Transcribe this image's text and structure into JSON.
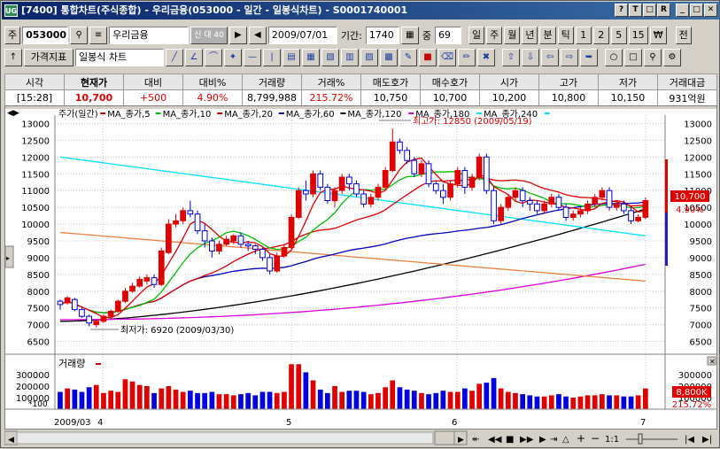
{
  "window": {
    "app_icon": "UG",
    "title": "[7400] 통합차트(주식종합) - 우리금융(053000 - 일간 - 일봉식차트) - S0001740001",
    "buttons": [
      "?",
      "T",
      "□",
      "R",
      "_",
      "□",
      "✕"
    ]
  },
  "toolbar1": {
    "code_prefix": "주",
    "stock_code": "053000",
    "stock_name": "우리금융",
    "credit_badge": "신 대 40",
    "date": "2009/07/01",
    "period_label": "기간:",
    "period_value": "1740",
    "zoom_label": "중",
    "zoom_value": "69",
    "period_buttons": [
      "일",
      "주",
      "월",
      "년",
      "분",
      "틱",
      "1",
      "2",
      "5",
      "15"
    ],
    "currency_button": "₩",
    "last_button": "전"
  },
  "toolbar2": {
    "index_button": "가격지표",
    "chart_type": "일봉식 차트",
    "tool_icons": [
      "line-icon",
      "angle-icon",
      "arc-icon",
      "fan-icon",
      "hline-icon",
      "vline-icon",
      "grid1-icon",
      "grid2-icon",
      "grid3-icon",
      "fib1-icon",
      "fib2-icon",
      "fib3-icon",
      "pencil-icon",
      "color-icon",
      "eraser-icon",
      "edit-icon",
      "delete-icon",
      "up-icon",
      "down-icon",
      "left-icon",
      "right-icon",
      "export-icon",
      "circle-icon",
      "square-icon",
      "zoom-icon",
      "setting-icon"
    ]
  },
  "quote": {
    "headers": [
      "시각",
      "현재가",
      "대비",
      "대비%",
      "거래량",
      "거래%",
      "매도호가",
      "매수호가",
      "시가",
      "고가",
      "저가",
      "거래대금"
    ],
    "values": [
      "[15:28]",
      "10,700",
      "+500",
      "4.90%",
      "8,799,988",
      "215.72%",
      "10,750",
      "10,700",
      "10,200",
      "10,800",
      "10,150",
      "931억원"
    ]
  },
  "chart": {
    "legend": [
      {
        "label": "주가(일간)",
        "color": "#000000"
      },
      {
        "label": "MA_종가,5",
        "color": "#e00000"
      },
      {
        "label": "MA_종가,10",
        "color": "#00c000"
      },
      {
        "label": "MA_종가,20",
        "color": "#e00000"
      },
      {
        "label": "MA_종가,60",
        "color": "#0000c0"
      },
      {
        "label": "MA_종가,120",
        "color": "#000000"
      },
      {
        "label": "MA_종가,180",
        "color": "#e000e0"
      },
      {
        "label": "MA_종가,240",
        "color": "#00e0ff"
      }
    ],
    "high_label": "최고가: 12850 (2009/05/19)",
    "low_label": "최저가: 6920 (2009/03/30)",
    "current_price_tag": "10,700",
    "current_pct_tag": "4.90%",
    "volume_title": "거래량",
    "volume_tag": "8,800K",
    "volume_pct": "215.72%",
    "volume_unit": "*100",
    "x_labels": [
      "2009/03",
      "4",
      "5",
      "6",
      "7"
    ],
    "price_ticks": [
      "13000",
      "12500",
      "12000",
      "11500",
      "11000",
      "10500",
      "10000",
      "9500",
      "9000",
      "8500",
      "8000",
      "7500",
      "7000",
      "6500"
    ],
    "volume_ticks": [
      "300000",
      "200000",
      "100000"
    ]
  },
  "chart_data": {
    "type": "candlestick",
    "title": "주가(일간)",
    "ylim": [
      6250,
      13250
    ],
    "high": {
      "value": 12850,
      "date": "2009/05/19"
    },
    "low": {
      "value": 6920,
      "date": "2009/03/30"
    },
    "candles": [
      [
        7700,
        7600,
        7750,
        7450
      ],
      [
        7650,
        7800,
        7850,
        7600
      ],
      [
        7750,
        7450,
        7800,
        7400
      ],
      [
        7450,
        7250,
        7500,
        7200
      ],
      [
        7250,
        7050,
        7300,
        6950
      ],
      [
        7000,
        7100,
        7150,
        6920
      ],
      [
        7100,
        7250,
        7300,
        7050
      ],
      [
        7250,
        7400,
        7450,
        7200
      ],
      [
        7400,
        7700,
        7750,
        7350
      ],
      [
        7700,
        8000,
        8100,
        7650
      ],
      [
        8000,
        8150,
        8250,
        7950
      ],
      [
        8150,
        8350,
        8450,
        8100
      ],
      [
        8300,
        8400,
        8500,
        8200
      ],
      [
        8400,
        8200,
        8500,
        8100
      ],
      [
        8200,
        9200,
        9300,
        8150
      ],
      [
        9150,
        10000,
        10150,
        9100
      ],
      [
        10000,
        10100,
        10300,
        9900
      ],
      [
        10100,
        10400,
        10500,
        10000
      ],
      [
        10400,
        10300,
        10700,
        10200
      ],
      [
        10300,
        9800,
        10400,
        9700
      ],
      [
        9800,
        9500,
        10000,
        9300
      ],
      [
        9500,
        9200,
        9600,
        9000
      ],
      [
        9200,
        9400,
        9500,
        9100
      ],
      [
        9400,
        9550,
        9650,
        9350
      ],
      [
        9500,
        9650,
        9700,
        9400
      ],
      [
        9650,
        9400,
        9750,
        9300
      ],
      [
        9400,
        9350,
        9500,
        9200
      ],
      [
        9350,
        9250,
        9400,
        9100
      ],
      [
        9250,
        9000,
        9300,
        8900
      ],
      [
        9000,
        8600,
        9100,
        8500
      ],
      [
        8600,
        9050,
        9150,
        8550
      ],
      [
        9050,
        9300,
        9400,
        9000
      ],
      [
        9300,
        10200,
        10300,
        9250
      ],
      [
        10200,
        11000,
        11100,
        10150
      ],
      [
        11000,
        10900,
        11300,
        10700
      ],
      [
        10900,
        11500,
        11600,
        10800
      ],
      [
        11500,
        11100,
        11600,
        11000
      ],
      [
        11100,
        10700,
        11200,
        10600
      ],
      [
        10700,
        11000,
        11100,
        10500
      ],
      [
        11000,
        11400,
        11500,
        10900
      ],
      [
        11400,
        11200,
        11500,
        11000
      ],
      [
        11200,
        10900,
        11300,
        10800
      ],
      [
        10900,
        10600,
        11000,
        10500
      ],
      [
        10600,
        10800,
        10900,
        10500
      ],
      [
        10800,
        11100,
        11200,
        10700
      ],
      [
        11100,
        11600,
        11700,
        11050
      ],
      [
        11600,
        12450,
        12850,
        11550
      ],
      [
        12450,
        12200,
        12550,
        12100
      ],
      [
        12200,
        11900,
        12300,
        11800
      ],
      [
        11900,
        11500,
        12000,
        11400
      ],
      [
        11500,
        11800,
        11900,
        11400
      ],
      [
        11800,
        11200,
        11900,
        11100
      ],
      [
        11200,
        11000,
        11300,
        10900
      ],
      [
        11000,
        10800,
        11200,
        10600
      ],
      [
        10800,
        11200,
        11300,
        10700
      ],
      [
        11200,
        11600,
        11700,
        11100
      ],
      [
        11600,
        11100,
        11700,
        10900
      ],
      [
        11100,
        11400,
        11500,
        11000
      ],
      [
        11400,
        12000,
        12100,
        11300
      ],
      [
        12000,
        11000,
        12100,
        10900
      ],
      [
        11000,
        10100,
        11100,
        10000
      ],
      [
        10100,
        10500,
        10600,
        10000
      ],
      [
        10500,
        10800,
        10900,
        10400
      ],
      [
        10800,
        11000,
        11100,
        10700
      ],
      [
        11000,
        10700,
        11100,
        10500
      ],
      [
        10700,
        10600,
        10800,
        10400
      ],
      [
        10600,
        10400,
        10700,
        10300
      ],
      [
        10400,
        10600,
        10700,
        10300
      ],
      [
        10600,
        10800,
        10900,
        10500
      ],
      [
        10800,
        10500,
        10900,
        10400
      ],
      [
        10500,
        10200,
        10600,
        10100
      ],
      [
        10200,
        10300,
        10400,
        10100
      ],
      [
        10300,
        10400,
        10500,
        10200
      ],
      [
        10400,
        10600,
        10700,
        10300
      ],
      [
        10600,
        10800,
        10900,
        10500
      ],
      [
        10800,
        11000,
        11100,
        10700
      ],
      [
        11000,
        10500,
        11100,
        10400
      ],
      [
        10500,
        10600,
        10700,
        10400
      ],
      [
        10600,
        10400,
        10700,
        10300
      ],
      [
        10400,
        10100,
        10500,
        10000
      ],
      [
        10100,
        10200,
        10300,
        10050
      ],
      [
        10200,
        10700,
        10800,
        10150
      ]
    ],
    "ma_series": [
      {
        "name": "MA_종가,5",
        "color": "#e00000"
      },
      {
        "name": "MA_종가,10",
        "color": "#00c000"
      },
      {
        "name": "MA_종가,20",
        "color": "#e00000"
      },
      {
        "name": "MA_종가,60",
        "color": "#0000c0"
      },
      {
        "name": "MA_종가,120",
        "color": "#000000",
        "start": 7100,
        "end": 10450
      },
      {
        "name": "MA_종가,180",
        "color": "#e000e0",
        "start": 7150,
        "end": 8800
      },
      {
        "name": "MA_종가,240",
        "color": "#00e0ff",
        "start": 12000,
        "end": 9650
      },
      {
        "name": "MA_종가,240b",
        "color": "#f08040",
        "start": 9750,
        "end": 8300
      }
    ],
    "volume": [
      150,
      180,
      170,
      150,
      190,
      210,
      140,
      160,
      150,
      260,
      240,
      210,
      200,
      140,
      180,
      200,
      170,
      150,
      160,
      140,
      140,
      150,
      130,
      130,
      120,
      130,
      140,
      120,
      150,
      150,
      140,
      150,
      390,
      390,
      320,
      250,
      170,
      140,
      200,
      150,
      160,
      160,
      150,
      130,
      140,
      190,
      250,
      190,
      170,
      160,
      140,
      130,
      140,
      160,
      150,
      150,
      180,
      160,
      220,
      230,
      270,
      180,
      150,
      140,
      130,
      120,
      110,
      110,
      120,
      130,
      110,
      100,
      110,
      120,
      120,
      130,
      120,
      120,
      110,
      110,
      120,
      180
    ],
    "volume_ylim": [
      0,
      400000
    ]
  }
}
